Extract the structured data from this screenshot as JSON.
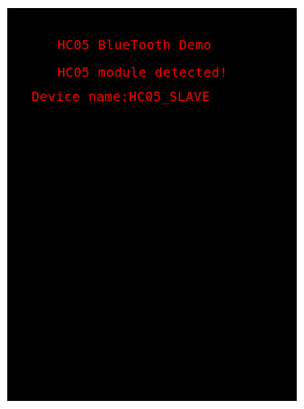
{
  "display": {
    "text_color": "#ff0000",
    "background_color": "#000000",
    "lines": [
      "HC05 BlueTooth Demo",
      "HC05 module detected!",
      "Device name:HC05_SLAVE"
    ]
  }
}
